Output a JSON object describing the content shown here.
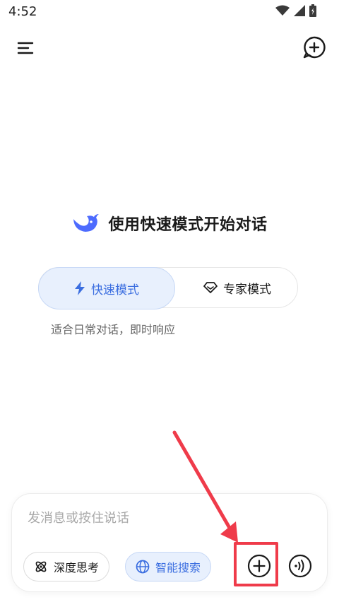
{
  "status_bar": {
    "time": "4:52",
    "icons": [
      "wifi-icon",
      "signal-icon",
      "battery-icon"
    ]
  },
  "header": {
    "menu_icon": "menu-icon",
    "new_chat_icon": "new-chat-icon"
  },
  "hero": {
    "logo": "whale-logo",
    "title": "使用快速模式开始对话"
  },
  "mode_toggle": {
    "fast_label": "快速模式",
    "expert_label": "专家模式",
    "selected": "快速模式",
    "description": "适合日常对话，即时响应"
  },
  "composer": {
    "placeholder": "发消息或按住说话",
    "deep_think_label": "深度思考",
    "smart_search_label": "智能搜索"
  },
  "colors": {
    "accent": "#3b6ee0",
    "accent_bg": "#e8f0fd",
    "annotation": "#ef3b4a"
  }
}
